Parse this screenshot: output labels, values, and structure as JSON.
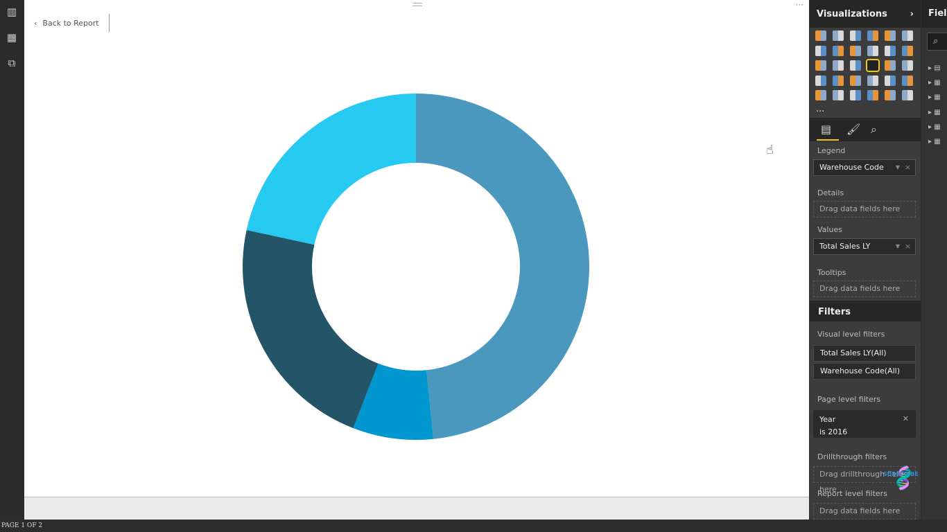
{
  "left_rail": {
    "items": [
      {
        "name": "report-view-icon",
        "glyph": "📊"
      },
      {
        "name": "data-view-icon",
        "glyph": "▦"
      },
      {
        "name": "relationships-view-icon",
        "glyph": "⧉"
      }
    ]
  },
  "canvas": {
    "back_label": "Back to Report",
    "back_icon": "chevron-left-icon"
  },
  "chart_data": {
    "type": "pie",
    "variant": "donut",
    "note_values_are": "share of total (%), estimated from slice angles; no labels shown",
    "categories": [
      "",
      "",
      "",
      ""
    ],
    "values": [
      48.4,
      7.5,
      22.5,
      21.6
    ],
    "colors": [
      "#4a98be",
      "#0096cf",
      "#235468",
      "#26c9ef"
    ],
    "legend": "none"
  },
  "status": {
    "page": "PAGE 1 OF 2"
  },
  "visualizations": {
    "title": "Visualizations",
    "icons": [
      "stacked-bar",
      "stacked-column",
      "clustered-bar",
      "clustered-column",
      "100-stacked-bar",
      "100-stacked-column",
      "line",
      "area",
      "stacked-area",
      "line-clustered-column",
      "line-stacked-column",
      "ribbon",
      "waterfall",
      "scatter",
      "pie",
      "donut",
      "treemap",
      "map",
      "filled-map",
      "shape-map",
      "funnel",
      "gauge",
      "multi-row-card",
      "card",
      "kpi",
      "slicer",
      "table",
      "matrix",
      "r-visual",
      "globe"
    ],
    "selected": "donut",
    "more": "...",
    "legend_label": "Legend",
    "legend_value": "Warehouse Code",
    "details_label": "Details",
    "details_placeholder": "Drag data fields here",
    "values_label": "Values",
    "values_value": "Total Sales LY",
    "tooltips_label": "Tooltips",
    "tooltips_placeholder": "Drag data fields here"
  },
  "filters": {
    "title": "Filters",
    "visual_label": "Visual level filters",
    "visual_items": [
      "Total Sales LY(All)",
      "Warehouse Code(All)"
    ],
    "page_label": "Page level filters",
    "page_filter_field": "Year",
    "page_filter_value": "is 2016",
    "drill_label": "Drillthrough filters",
    "drill_placeholder": "Drag drillthrough fields here",
    "report_label": "Report level filters",
    "report_placeholder": "Drag data fields here",
    "watermark": "SUBSCRIBE"
  },
  "fields": {
    "title": "Fields"
  },
  "accent": "#f2c811"
}
